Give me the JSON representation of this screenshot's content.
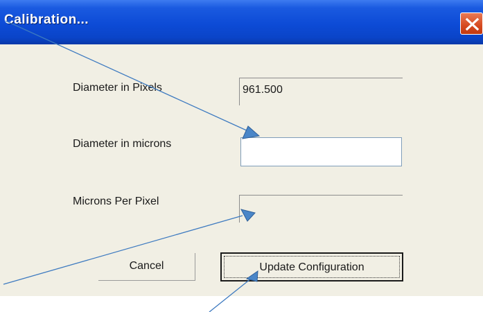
{
  "dialog": {
    "title": "Calibration...",
    "close_icon": "close-x-icon",
    "colors": {
      "titlebar": "#0d4bd6",
      "close_button": "#d64a1f",
      "body": "#f1efe4",
      "annotation_arrow": "#4a86c8"
    }
  },
  "form": {
    "diameter_pixels_label": "Diameter in Pixels",
    "diameter_pixels_value": "961.500",
    "diameter_microns_label": "Diameter in microns",
    "diameter_microns_value": "",
    "microns_per_pixel_label": "Microns Per Pixel",
    "microns_per_pixel_value": ""
  },
  "buttons": {
    "cancel_label": "Cancel",
    "update_label": "Update Configuration"
  }
}
